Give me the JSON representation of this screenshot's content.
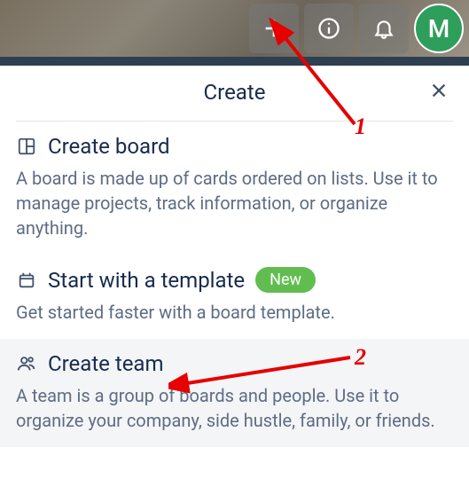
{
  "topbar": {
    "avatar_initial": "M"
  },
  "popover": {
    "title": "Create"
  },
  "options": {
    "create_board": {
      "title": "Create board",
      "desc": "A board is made up of cards ordered on lists. Use it to manage projects, track information, or organize anything."
    },
    "start_template": {
      "title": "Start with a template",
      "badge": "New",
      "desc": "Get started faster with a board template."
    },
    "create_team": {
      "title": "Create team",
      "desc": "A team is a group of boards and people. Use it to organize your company, side hustle, family, or friends."
    }
  },
  "annotations": {
    "label1": "1",
    "label2": "2"
  }
}
